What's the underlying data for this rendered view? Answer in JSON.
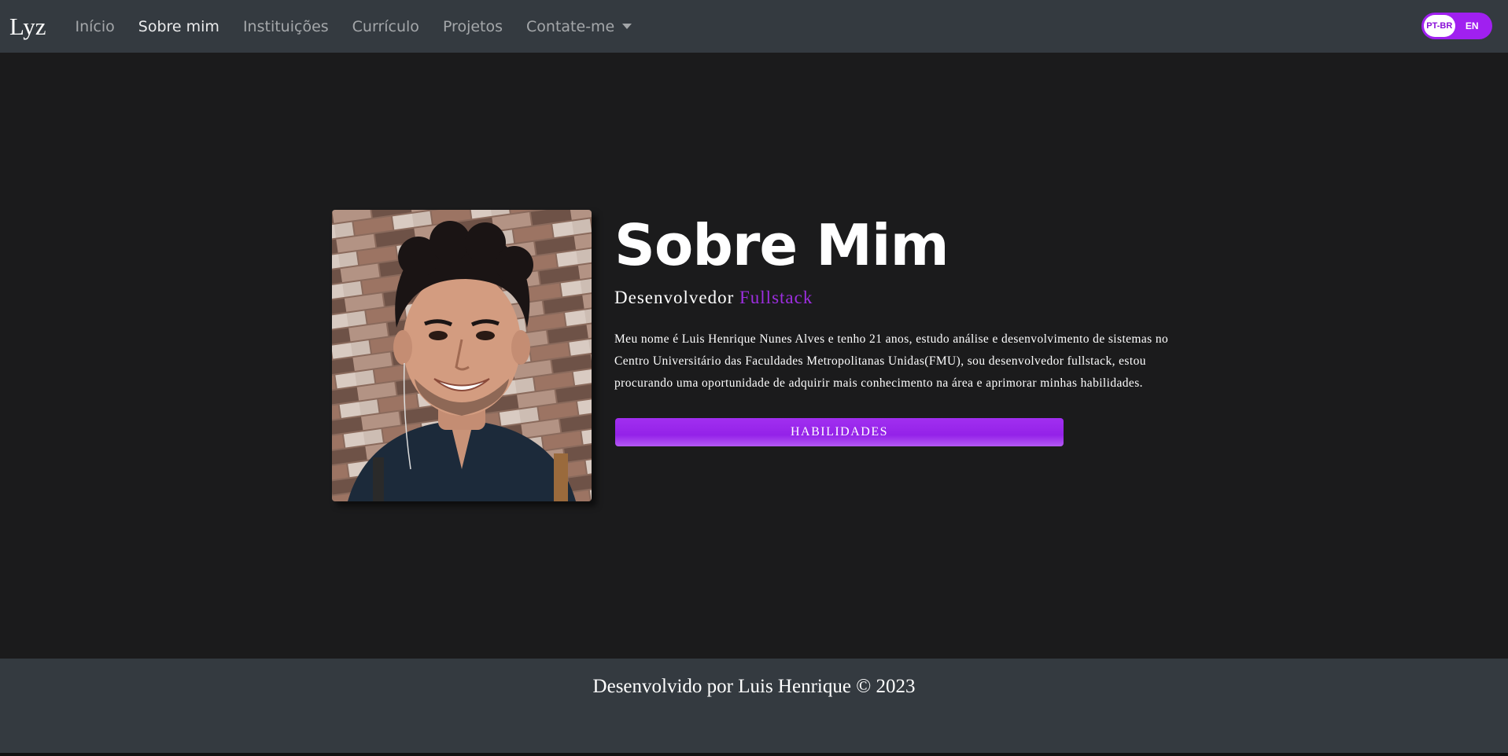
{
  "navbar": {
    "brand": "Lyz",
    "links": [
      {
        "label": "Início"
      },
      {
        "label": "Sobre mim",
        "active": true
      },
      {
        "label": "Instituições"
      },
      {
        "label": "Currículo"
      },
      {
        "label": "Projetos"
      },
      {
        "label": "Contate-me",
        "dropdown": true
      }
    ],
    "language_toggle": {
      "selected": "PT-BR",
      "other": "EN",
      "color": "#a020f0"
    }
  },
  "about": {
    "title": "Sobre Mim",
    "subtitle_prefix": "Desenvolvedor",
    "subtitle_accent": "Fullstack",
    "bio": "Meu nome é Luis Henrique Nunes Alves e tenho 21 anos, estudo análise e desenvolvimento de sistemas no Centro Universitário das Faculdades Metropolitanas Unidas(FMU), sou desenvolvedor fullstack, estou procurando uma oportunidade de adquirir mais conhecimento na área e aprimorar minhas habilidades.",
    "button_label": "HABILIDADES",
    "accent_color": "#9d2ee0"
  },
  "footer": {
    "text": "Desenvolvido por Luis Henrique © 2023"
  }
}
